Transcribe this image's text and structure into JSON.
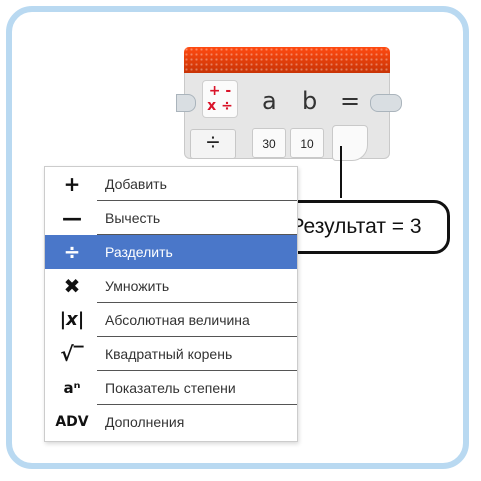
{
  "block": {
    "mode_icon_top": "+ -",
    "mode_icon_bottom": "x ÷",
    "param_a": "a",
    "param_b": "b",
    "param_eq": "=",
    "mode_selector_symbol": "÷",
    "input_a_value": "30",
    "input_b_value": "10",
    "header_color": "#e8410b"
  },
  "callout": {
    "text": "Результат = 3"
  },
  "menu": {
    "items": [
      {
        "icon": "plus-icon",
        "glyph": "+",
        "label": "Добавить",
        "selected": false
      },
      {
        "icon": "minus-icon",
        "glyph": "—",
        "label": "Вычесть",
        "selected": false
      },
      {
        "icon": "divide-icon",
        "glyph": "÷",
        "label": "Разделить",
        "selected": true
      },
      {
        "icon": "multiply-icon",
        "glyph": "✖",
        "label": "Умножить",
        "selected": false
      },
      {
        "icon": "absolute-value-icon",
        "glyph": "|x|",
        "label": "Абсолютная величина",
        "selected": false
      },
      {
        "icon": "square-root-icon",
        "glyph": "√‾",
        "label": "Квадратный корень",
        "selected": false
      },
      {
        "icon": "exponent-icon",
        "glyph": "aⁿ",
        "label": "Показатель степени",
        "selected": false
      },
      {
        "icon": "advanced-icon",
        "glyph": "ADV",
        "label": "Дополнения",
        "selected": false
      }
    ],
    "selected_color": "#4a77c9"
  },
  "frame_color": "#b9d9f1"
}
